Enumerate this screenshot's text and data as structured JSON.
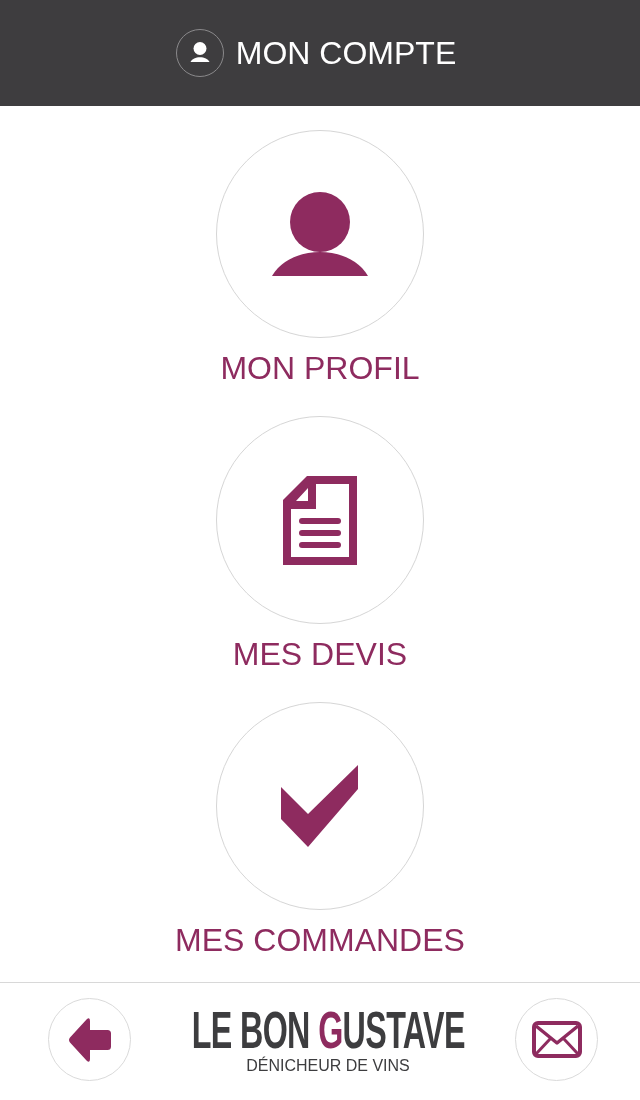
{
  "header": {
    "title": "MON COMPTE"
  },
  "menu": [
    {
      "kind": "profile",
      "label": "MON PROFIL"
    },
    {
      "kind": "document",
      "label": "MES DEVIS"
    },
    {
      "kind": "check",
      "label": "MES COMMANDES"
    }
  ],
  "footer": {
    "logo": [
      {
        "text": "LE BON ",
        "color": "#3d3d3f"
      },
      {
        "text": "G",
        "color": "#8e2b5f"
      },
      {
        "text": "USTAVE",
        "color": "#3d3d3f"
      }
    ],
    "tagline": "DÉNICHEUR DE VINS"
  }
}
